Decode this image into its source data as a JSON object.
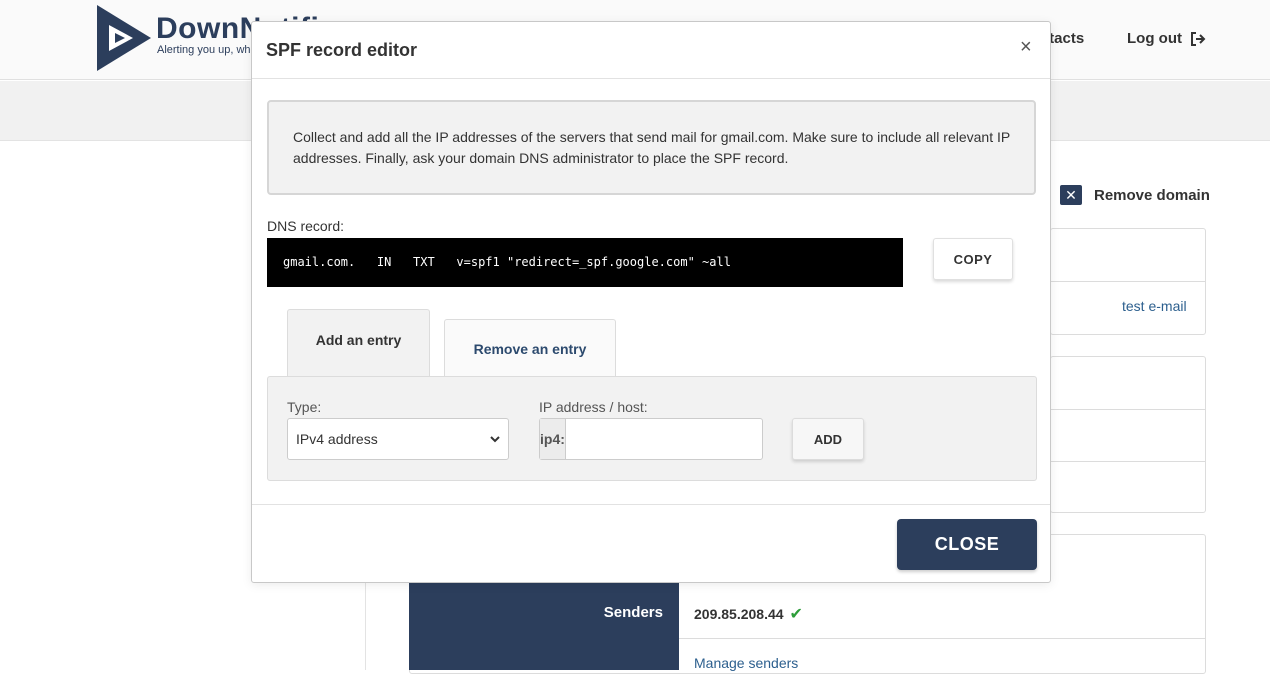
{
  "app": {
    "brand_name": "DownNotifi",
    "brand_tagline": "Alerting you up, whe",
    "nav": {
      "contacts_label": "ntacts",
      "logout_label": "Log out"
    },
    "remove_domain_label": "Remove domain",
    "test_email_label": "test e-mail",
    "senders": {
      "label": "Senders",
      "ip": "209.85.208.44",
      "manage_label": "Manage senders"
    },
    "colors": {
      "brand": "#2c3e5c",
      "link": "#2c5f8e",
      "success": "#2e9e3a"
    }
  },
  "modal": {
    "title": "SPF record editor",
    "close_icon": "×",
    "info_text": "Collect and add all the IP addresses of the servers that send mail for gmail.com. Make sure to include all relevant IP addresses. Finally, ask your domain DNS administrator to place the SPF record.",
    "dns_label": "DNS record:",
    "dns_record": "gmail.com.   IN   TXT   v=spf1 \"redirect=_spf.google.com\" ~all",
    "copy_label": "COPY",
    "tabs": [
      {
        "label": "Add an entry",
        "active": true
      },
      {
        "label": "Remove an entry",
        "active": false
      }
    ],
    "form": {
      "type_label": "Type:",
      "type_value": "IPv4 address",
      "ip_label": "IP address / host:",
      "ip_prefix": "ip4:",
      "ip_value": "",
      "add_label": "ADD"
    },
    "close_label": "CLOSE"
  }
}
